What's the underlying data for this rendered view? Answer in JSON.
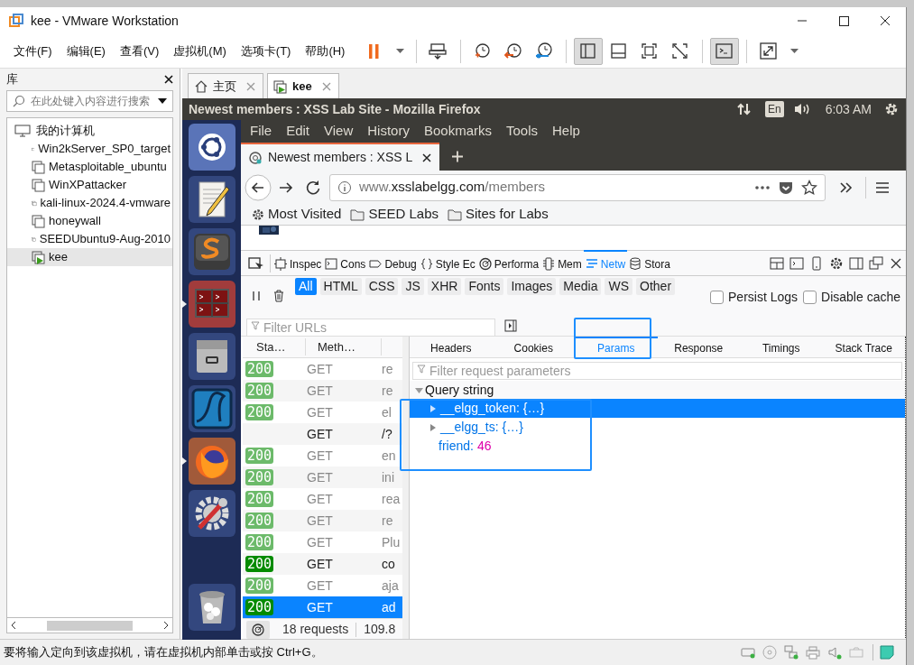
{
  "window": {
    "title": "kee - VMware Workstation"
  },
  "menu": [
    "文件(F)",
    "编辑(E)",
    "查看(V)",
    "虚拟机(M)",
    "选项卡(T)",
    "帮助(H)"
  ],
  "toolbar": [
    [
      {
        "kind": "pause",
        "pressed": false
      },
      {
        "kind": "caret",
        "pressed": false
      }
    ],
    [
      {
        "kind": "send-keys",
        "pressed": false
      }
    ],
    [
      {
        "kind": "snapshot-take",
        "pressed": false
      },
      {
        "kind": "snapshot-revert",
        "pressed": false
      },
      {
        "kind": "snapshot-manage",
        "pressed": false
      }
    ],
    [
      {
        "kind": "view-library",
        "pressed": true
      },
      {
        "kind": "view-thumbnail",
        "pressed": false
      },
      {
        "kind": "view-fullscreen",
        "pressed": false
      },
      {
        "kind": "view-unity",
        "pressed": false
      }
    ],
    [
      {
        "kind": "console",
        "pressed": true
      }
    ],
    [
      {
        "kind": "stretch",
        "pressed": false
      },
      {
        "kind": "caret",
        "pressed": false
      }
    ]
  ],
  "library": {
    "title": "库",
    "search": {
      "placeholder": "在此处键入内容进行搜索"
    },
    "tree": [
      {
        "label": "我的计算机",
        "children": [
          {
            "label": "Win2kServer_SP0_target",
            "running": false,
            "selected": false
          },
          {
            "label": "Metasploitable_ubuntu",
            "running": false,
            "selected": false
          },
          {
            "label": "WinXPattacker",
            "running": false,
            "selected": false
          },
          {
            "label": "kali-linux-2024.4-vmware",
            "running": false,
            "selected": false
          },
          {
            "label": "honeywall",
            "running": false,
            "selected": false
          },
          {
            "label": "SEEDUbuntu9-Aug-2010",
            "running": false,
            "selected": false
          },
          {
            "label": "kee",
            "running": true,
            "selected": true
          }
        ]
      }
    ]
  },
  "tabs": [
    {
      "label": "主页",
      "kind": "home",
      "selected": false
    },
    {
      "label": "kee",
      "kind": "vm",
      "selected": true
    }
  ],
  "guest": {
    "top_bar": {
      "title": "Newest members : XSS Lab Site - Mozilla Firefox",
      "keyboard": "En",
      "clock": "6:03 AM"
    },
    "launcher": [
      {
        "kind": "ubuntu",
        "running": false
      },
      {
        "kind": "editor",
        "running": false
      },
      {
        "kind": "sublime",
        "running": false
      },
      {
        "kind": "terminal",
        "running": true
      },
      {
        "kind": "files",
        "running": false
      },
      {
        "kind": "wireshark",
        "running": false
      },
      {
        "kind": "firefox",
        "running": true
      },
      {
        "kind": "settings",
        "running": false
      },
      {
        "kind": "trash",
        "running": false
      }
    ]
  },
  "firefox": {
    "menu": [
      "File",
      "Edit",
      "View",
      "History",
      "Bookmarks",
      "Tools",
      "Help"
    ],
    "tab": {
      "title": "Newest members : XSS L"
    },
    "url": {
      "prefix": "www.",
      "host": "xsslabelgg.com",
      "path": "/members"
    },
    "bookmarks": [
      {
        "kind": "gear",
        "label": "Most Visited"
      },
      {
        "kind": "folder",
        "label": "SEED Labs"
      },
      {
        "kind": "folder",
        "label": "Sites for Labs"
      }
    ]
  },
  "devtools": {
    "tabs": [
      {
        "label": "Inspec",
        "kind": "inspector",
        "selected": false
      },
      {
        "label": "Cons",
        "kind": "console",
        "selected": false
      },
      {
        "label": "Debug",
        "kind": "debugger",
        "selected": false
      },
      {
        "label": "Style Ec",
        "kind": "style",
        "selected": false
      },
      {
        "label": "Performa",
        "kind": "performance",
        "selected": false
      },
      {
        "label": "Mem",
        "kind": "memory",
        "selected": false
      },
      {
        "label": "Netw",
        "kind": "network",
        "selected": true
      },
      {
        "label": "Stora",
        "kind": "storage",
        "selected": false
      }
    ],
    "filters": [
      {
        "label": "All",
        "selected": true
      },
      {
        "label": "HTML",
        "selected": false
      },
      {
        "label": "CSS",
        "selected": false
      },
      {
        "label": "JS",
        "selected": false
      },
      {
        "label": "XHR",
        "selected": false
      },
      {
        "label": "Fonts",
        "selected": false
      },
      {
        "label": "Images",
        "selected": false
      },
      {
        "label": "Media",
        "selected": false
      },
      {
        "label": "WS",
        "selected": false
      },
      {
        "label": "Other",
        "selected": false
      }
    ],
    "options": [
      {
        "label": "Persist Logs",
        "checked": false
      },
      {
        "label": "Disable cache",
        "checked": false
      }
    ],
    "filter_urls": {
      "placeholder": "Filter URLs"
    },
    "columns": [
      "Sta…",
      "Meth…"
    ],
    "requests": [
      {
        "status": "200",
        "method": "GET",
        "file": "re",
        "cached": true,
        "selected": false
      },
      {
        "status": "200",
        "method": "GET",
        "file": "re",
        "cached": true,
        "selected": false
      },
      {
        "status": "200",
        "method": "GET",
        "file": "el",
        "cached": true,
        "selected": false
      },
      {
        "method": "GET",
        "file": "/?",
        "cached": false,
        "selected": false
      },
      {
        "status": "200",
        "method": "GET",
        "file": "en",
        "cached": true,
        "selected": false
      },
      {
        "status": "200",
        "method": "GET",
        "file": "ini",
        "cached": true,
        "selected": false
      },
      {
        "status": "200",
        "method": "GET",
        "file": "rea",
        "cached": true,
        "selected": false
      },
      {
        "status": "200",
        "method": "GET",
        "file": "re",
        "cached": true,
        "selected": false
      },
      {
        "status": "200",
        "method": "GET",
        "file": "Plu",
        "cached": true,
        "selected": false
      },
      {
        "status": "200",
        "method": "GET",
        "file": "co",
        "cached": false,
        "selected": false
      },
      {
        "status": "200",
        "method": "GET",
        "file": "aja",
        "cached": true,
        "selected": false
      },
      {
        "status": "200",
        "method": "GET",
        "file": "ad",
        "cached": false,
        "selected": true
      }
    ],
    "footer": {
      "count": "18 requests",
      "size": "109.8"
    },
    "detail_tabs": [
      {
        "label": "Headers",
        "selected": false
      },
      {
        "label": "Cookies",
        "selected": false
      },
      {
        "label": "Params",
        "selected": true
      },
      {
        "label": "Response",
        "selected": false
      },
      {
        "label": "Timings",
        "selected": false
      },
      {
        "label": "Stack Trace",
        "selected": false
      }
    ],
    "param_filter": {
      "placeholder": "Filter request parameters"
    },
    "params": {
      "section": "Query string",
      "expanded": true,
      "items": [
        {
          "kind": "object",
          "label": "__elgg_token: {…}",
          "expanded": false,
          "selected": true
        },
        {
          "kind": "object",
          "label": "__elgg_ts: {…}",
          "expanded": false,
          "selected": false
        },
        {
          "kind": "value",
          "key": "friend:",
          "value": "46",
          "selected": false
        }
      ]
    }
  },
  "status_bar": {
    "message": "要将输入定向到该虚拟机，请在虚拟机内部单击或按 Ctrl+G。"
  }
}
